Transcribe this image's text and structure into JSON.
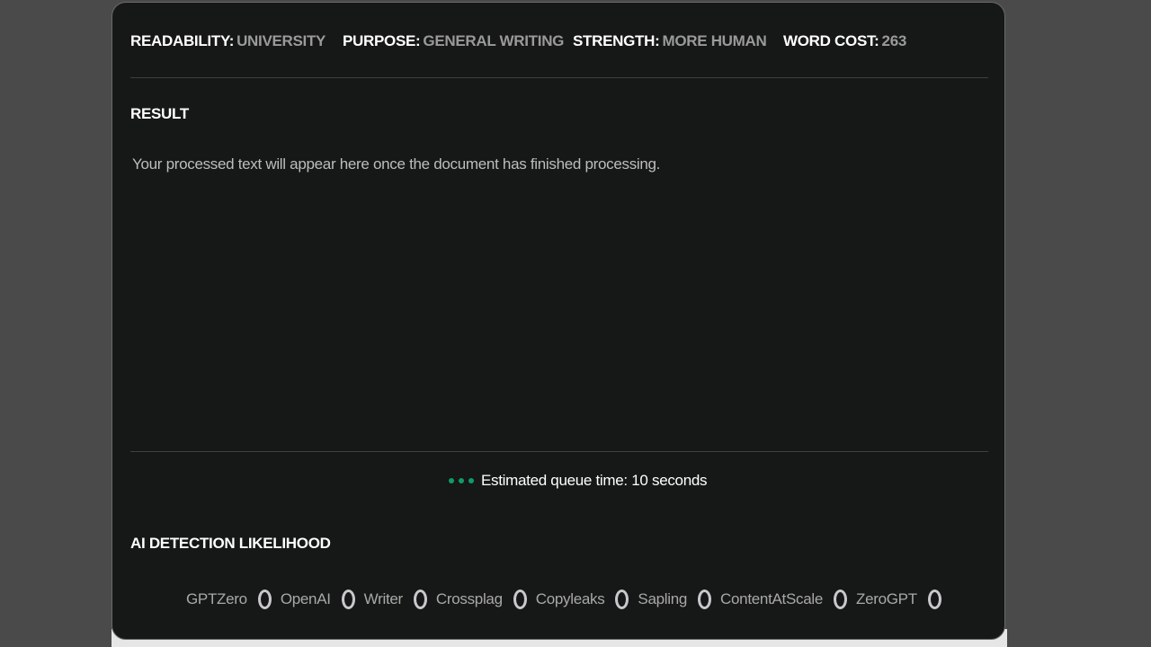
{
  "settings": {
    "readability": {
      "label": "READABILITY:",
      "value": "UNIVERSITY"
    },
    "purpose": {
      "label": "PURPOSE:",
      "value": "GENERAL WRITING"
    },
    "strength": {
      "label": "STRENGTH:",
      "value": "MORE HUMAN"
    },
    "word_cost": {
      "label": "WORD COST:",
      "value": "263"
    }
  },
  "result": {
    "title": "RESULT",
    "placeholder_text": "Your processed text will appear here once the document has finished processing."
  },
  "queue": {
    "text": "Estimated queue time: 10 seconds",
    "indicator_color": "#0f9b67"
  },
  "detection": {
    "title": "AI DETECTION LIKELIHOOD",
    "detectors": [
      {
        "name": "GPTZero",
        "icon": "ring-icon"
      },
      {
        "name": "OpenAI",
        "icon": "ring-icon"
      },
      {
        "name": "Writer",
        "icon": "ring-icon"
      },
      {
        "name": "Crossplag",
        "icon": "ring-icon"
      },
      {
        "name": "Copyleaks",
        "icon": "ring-icon"
      },
      {
        "name": "Sapling",
        "icon": "ring-icon"
      },
      {
        "name": "ContentAtScale",
        "icon": "ring-icon"
      },
      {
        "name": "ZeroGPT",
        "icon": "ring-icon"
      }
    ]
  },
  "colors": {
    "panel_bg": "#161717",
    "page_bg": "#4a4a4a",
    "accent_green": "#0f9b67"
  }
}
